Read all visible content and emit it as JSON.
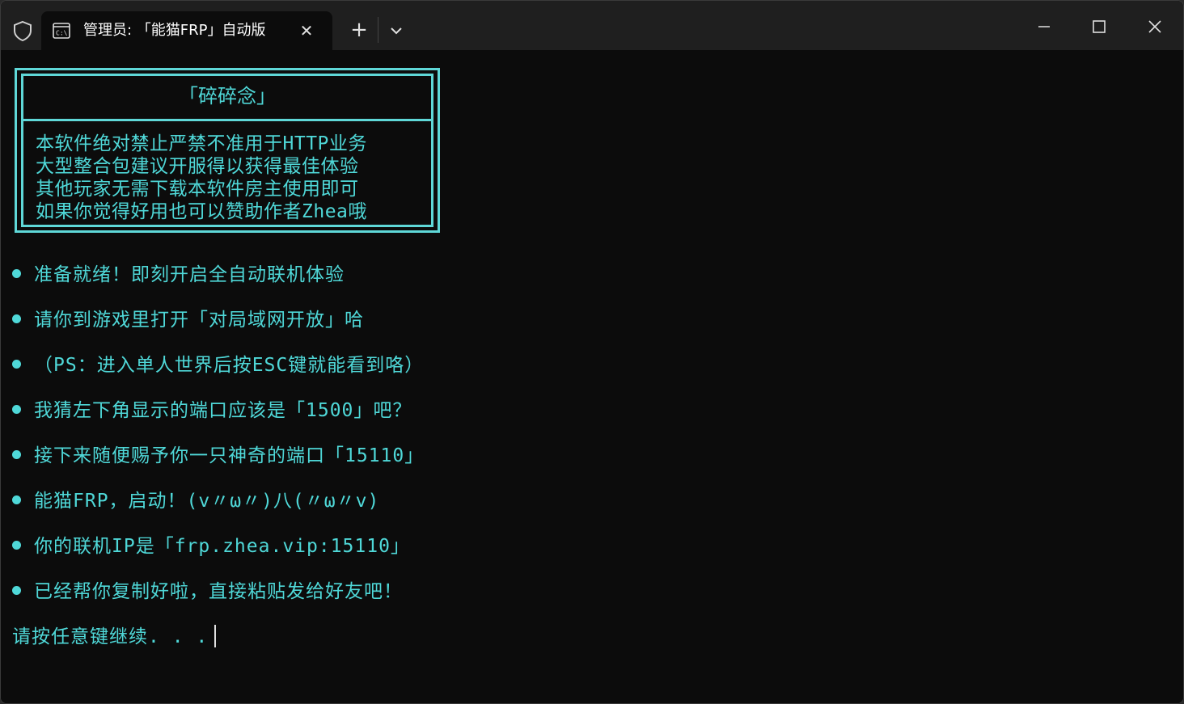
{
  "window": {
    "tab_title": "管理员: 「能猫FRP」自动版",
    "tab_close_glyph": "✕",
    "new_tab_glyph": "+"
  },
  "console": {
    "box_title": "「碎碎念」",
    "box_lines": [
      "本软件绝对禁止严禁不准用于HTTP业务",
      "大型整合包建议开服得以获得最佳体验",
      "其他玩家无需下载本软件房主使用即可",
      "如果你觉得好用也可以赞助作者Zhea哦"
    ],
    "messages": [
      "准备就绪！即刻开启全自动联机体验",
      "请你到游戏里打开「对局域网开放」哈",
      "（PS：进入单人世界后按ESC键就能看到咯）",
      "我猜左下角显示的端口应该是「1500」吧？",
      "接下来随便赐予你一只神奇的端口「15110」",
      "能猫FRP，启动！(v〃ω〃)八(〃ω〃v)",
      "你的联机IP是「frp.zhea.vip:15110」",
      "已经帮你复制好啦，直接粘贴发给好友吧！"
    ],
    "prompt": "请按任意键继续. . ."
  },
  "colors": {
    "text": "#4fd8d8",
    "background": "#0c0c0c",
    "titlebar": "#1f1f1f"
  }
}
